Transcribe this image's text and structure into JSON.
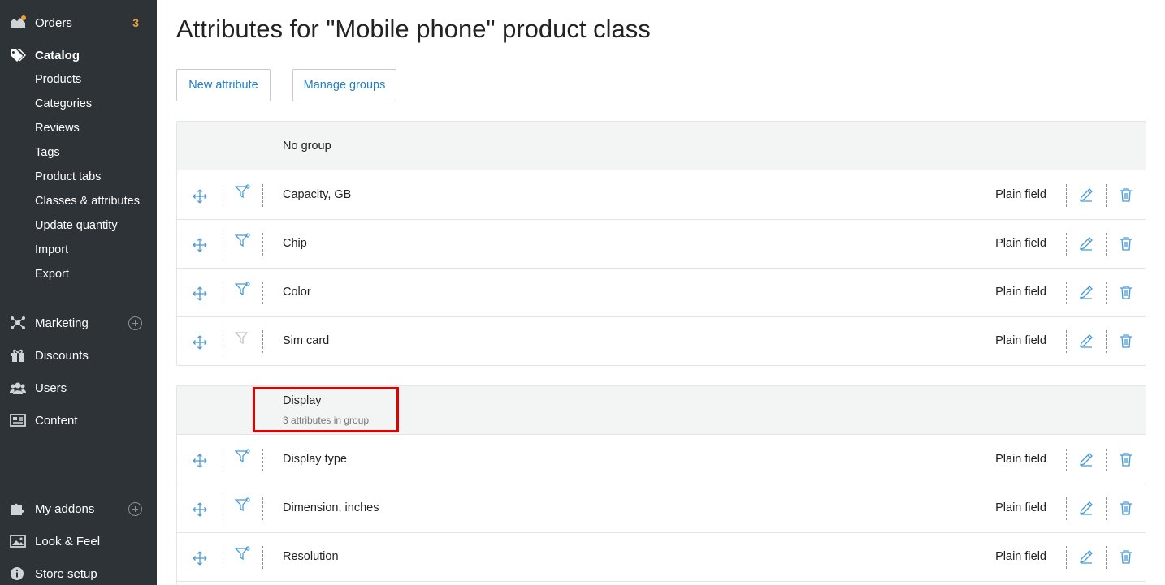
{
  "sidebar": {
    "orders": {
      "label": "Orders",
      "badge": "3"
    },
    "catalog": {
      "label": "Catalog"
    },
    "catalog_items": [
      "Products",
      "Categories",
      "Reviews",
      "Tags",
      "Product tabs",
      "Classes & attributes",
      "Update quantity",
      "Import",
      "Export"
    ],
    "marketing": {
      "label": "Marketing"
    },
    "discounts": {
      "label": "Discounts"
    },
    "users": {
      "label": "Users"
    },
    "content": {
      "label": "Content"
    },
    "my_addons": {
      "label": "My addons"
    },
    "look_feel": {
      "label": "Look & Feel"
    },
    "store_setup": {
      "label": "Store setup"
    }
  },
  "page": {
    "title": "Attributes for \"Mobile phone\" product class",
    "new_attribute_label": "New attribute",
    "manage_groups_label": "Manage groups"
  },
  "groups": [
    {
      "name": "No group",
      "subtitle": "",
      "rows": [
        {
          "name": "Capacity, GB",
          "type": "Plain field",
          "filterable": true
        },
        {
          "name": "Chip",
          "type": "Plain field",
          "filterable": true
        },
        {
          "name": "Color",
          "type": "Plain field",
          "filterable": true
        },
        {
          "name": "Sim card",
          "type": "Plain field",
          "filterable": false
        }
      ]
    },
    {
      "name": "Display",
      "subtitle": "3 attributes in group",
      "rows": [
        {
          "name": "Display type",
          "type": "Plain field",
          "filterable": true
        },
        {
          "name": "Dimension, inches",
          "type": "Plain field",
          "filterable": true
        },
        {
          "name": "Resolution",
          "type": "Plain field",
          "filterable": true
        }
      ]
    }
  ],
  "colors": {
    "sidebar_bg": "#2d3337",
    "accent": "#1d7fc7",
    "badge": "#f0a030",
    "highlight": "#e00000"
  }
}
